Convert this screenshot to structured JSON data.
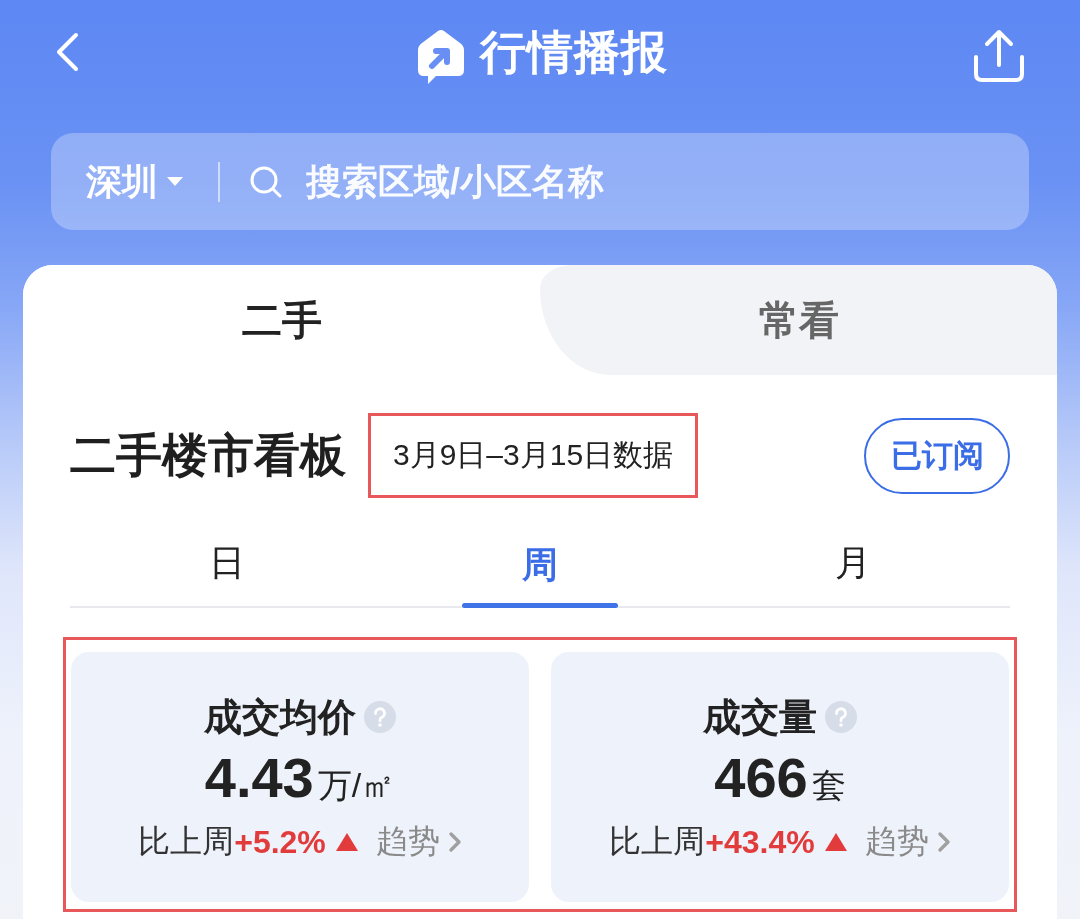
{
  "header": {
    "title": "行情播报"
  },
  "search": {
    "city": "深圳",
    "placeholder": "搜索区域/小区名称"
  },
  "market_tabs": [
    {
      "label": "二手",
      "selected": true
    },
    {
      "label": "常看",
      "selected": false
    }
  ],
  "board": {
    "title": "二手楼市看板",
    "date_range": {
      "text": "3月9日–3月15日数据",
      "highlighted": true
    },
    "subscribe_button": {
      "label": "已订阅"
    }
  },
  "period_tabs": [
    {
      "label": "日",
      "selected": false
    },
    {
      "label": "周",
      "selected": true
    },
    {
      "label": "月",
      "selected": false
    }
  ],
  "stats": {
    "highlighted": true,
    "cards": [
      {
        "title": "成交均价",
        "value": "4.43",
        "unit": "万/㎡",
        "compare_label": "比上周",
        "change": "+5.2%",
        "rising": true,
        "trend_link": "趋势"
      },
      {
        "title": "成交量",
        "value": "466",
        "unit": "套",
        "compare_label": "比上周",
        "change": "+43.4%",
        "rising": true,
        "trend_link": "趋势"
      }
    ]
  }
}
